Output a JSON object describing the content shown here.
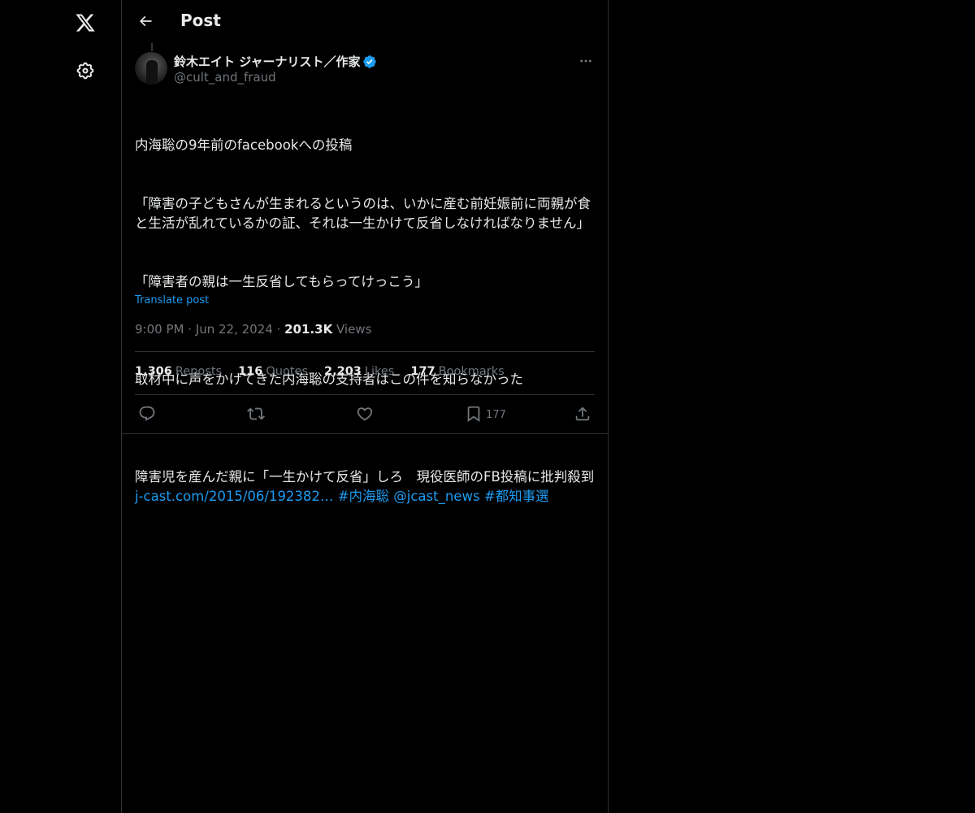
{
  "nav": {
    "logo_icon": "x-logo-icon",
    "settings_icon": "gear-icon"
  },
  "header": {
    "title": "Post",
    "back_icon": "arrow-left-icon"
  },
  "post": {
    "author": {
      "name": "鈴木エイト ジャーナリスト／作家",
      "handle": "@cult_and_fraud",
      "verified": true
    },
    "lines": [
      "内海聡の9年前のfacebookへの投稿",
      "「障害の子どもさんが生まれるというのは、いかに産む前妊娠前に両親が食と生活が乱れているかの証、それは一生かけて反省しなければなりません」",
      "「障害者の親は一生反省してもらってけっこう」",
      "",
      "取材中に声をかけてきた内海聡の支持者はこの件を知らなかった",
      ""
    ],
    "last_line": {
      "text": "障害児を産んだ親に「一生かけて反省」しろ　現役医師のFB投稿に批判殺到 ",
      "link": "j-cast.com/2015/06/192382…",
      "hashtag1": "#内海聡",
      "mention": "@jcast_news",
      "hashtag2": "#都知事選"
    },
    "translate_label": "Translate post",
    "time": "9:00 PM",
    "date": "Jun 22, 2024",
    "views_count": "201.3K",
    "views_label": "Views",
    "stats": {
      "reposts_count": "1,306",
      "reposts_label": "Reposts",
      "quotes_count": "116",
      "quotes_label": "Quotes",
      "likes_count": "2,203",
      "likes_label": "Likes",
      "bookmarks_count": "177",
      "bookmarks_label": "Bookmarks"
    },
    "actions": {
      "bookmark_count": "177"
    }
  },
  "colors": {
    "background": "#000000",
    "text": "#e7e9ea",
    "muted": "#71767b",
    "accent": "#1d9bf0",
    "border": "#2f3336"
  }
}
